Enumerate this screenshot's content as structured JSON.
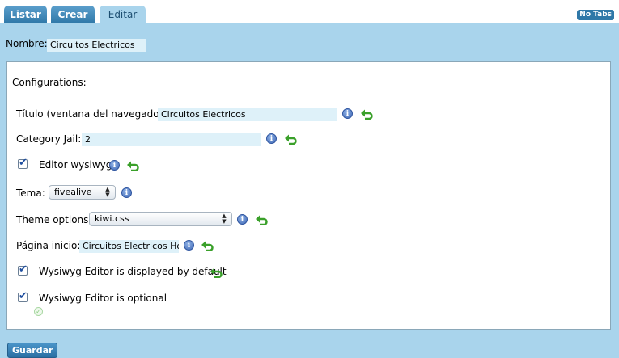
{
  "tabs": [
    {
      "label": "Listar"
    },
    {
      "label": "Crear"
    },
    {
      "label": "Editar"
    }
  ],
  "no_tabs_label": "No Tabs",
  "nombre": {
    "label": "Nombre:",
    "value": "Circuitos Electricos"
  },
  "section_title": "Configurations:",
  "titulo": {
    "label": "Título (ventana del navegador):",
    "value": "Circuitos Electricos"
  },
  "category_jail": {
    "label": "Category Jail:",
    "value": "2"
  },
  "editor_wysiwyg": {
    "label": "Editor wysiwyg",
    "checked": true
  },
  "tema": {
    "label": "Tema:",
    "value": "fivealive"
  },
  "theme_options": {
    "label": "Theme options:",
    "value": "kiwi.css"
  },
  "pagina_inicio": {
    "label": "Página inicio:",
    "value": "Circuitos Electricos Ho"
  },
  "wysiwyg_default": {
    "label": "Wysiwyg Editor is displayed by default",
    "checked": true
  },
  "wysiwyg_optional": {
    "label": "Wysiwyg Editor is optional",
    "checked": true
  },
  "save_label": "Guardar",
  "icons": {
    "info": "i"
  },
  "colors": {
    "panel": "#a9d4ec",
    "tab": "#2f78a8",
    "field": "#def1f9"
  }
}
